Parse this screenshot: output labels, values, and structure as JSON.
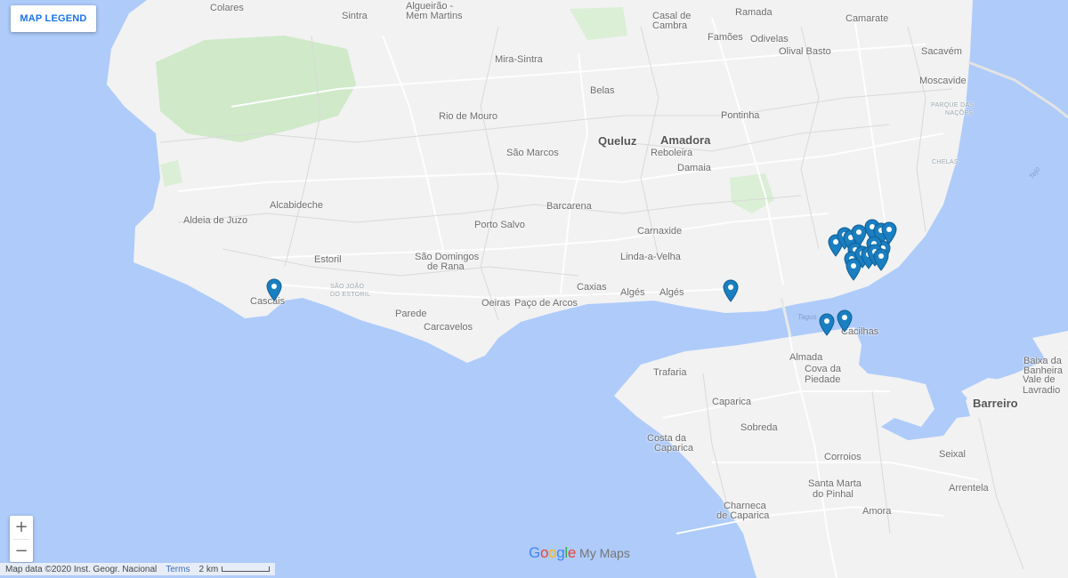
{
  "legend_button": "MAP LEGEND",
  "zoom": {
    "in": "+",
    "out": "−"
  },
  "attribution": {
    "data": "Map data ©2020 Inst. Geogr. Nacional",
    "terms": "Terms",
    "scale": "2 km"
  },
  "branding": {
    "google": "Google",
    "product": "My Maps"
  },
  "colors": {
    "water": "#aecbfa",
    "land": "#f2f2f2",
    "park": "#cfe9c9",
    "pin": "#1a7fc1"
  },
  "labels": [
    {
      "text": "Colares",
      "k": "n"
    },
    {
      "text": "Sintra",
      "k": "n"
    },
    {
      "text": "Algueirão -",
      "k": "n"
    },
    {
      "text": "Mem Martins",
      "k": "n"
    },
    {
      "text": "Mira-Sintra",
      "k": "n"
    },
    {
      "text": "Casal de",
      "k": "n"
    },
    {
      "text": "Cambra",
      "k": "n"
    },
    {
      "text": "Ramada",
      "k": "n"
    },
    {
      "text": "Famões",
      "k": "n"
    },
    {
      "text": "Odivelas",
      "k": "n"
    },
    {
      "text": "Camarate",
      "k": "n"
    },
    {
      "text": "Olival Basto",
      "k": "n"
    },
    {
      "text": "Sacavém",
      "k": "n"
    },
    {
      "text": "Moscavide",
      "k": "n"
    },
    {
      "text": "Belas",
      "k": "n"
    },
    {
      "text": "Rio de Mouro",
      "k": "n"
    },
    {
      "text": "Pontinha",
      "k": "n"
    },
    {
      "text": "Queluz",
      "k": "b"
    },
    {
      "text": "Amadora",
      "k": "b"
    },
    {
      "text": "São Marcos",
      "k": "n"
    },
    {
      "text": "Reboleira",
      "k": "n"
    },
    {
      "text": "Damaia",
      "k": "n"
    },
    {
      "text": "Alcabideche",
      "k": "n"
    },
    {
      "text": "Aldeia de Juzo",
      "k": "n"
    },
    {
      "text": "Barcarena",
      "k": "n"
    },
    {
      "text": "Porto Salvo",
      "k": "n"
    },
    {
      "text": "Carnaxide",
      "k": "n"
    },
    {
      "text": "Estoril",
      "k": "n"
    },
    {
      "text": "São Domingos",
      "k": "n"
    },
    {
      "text": "de Rana",
      "k": "n"
    },
    {
      "text": "Linda-a-Velha",
      "k": "n"
    },
    {
      "text": "Cascais",
      "k": "n"
    },
    {
      "text": "Caxias",
      "k": "n"
    },
    {
      "text": "Algés",
      "k": "n"
    },
    {
      "text": "Algés",
      "k": "n"
    },
    {
      "text": "Oeiras",
      "k": "n"
    },
    {
      "text": "Paço de Arcos",
      "k": "n"
    },
    {
      "text": "Parede",
      "k": "n"
    },
    {
      "text": "Carcavelos",
      "k": "n"
    },
    {
      "text": "Almada",
      "k": "n"
    },
    {
      "text": "Cova da",
      "k": "n"
    },
    {
      "text": "Piedade",
      "k": "n"
    },
    {
      "text": "Cacilhas",
      "k": "n"
    },
    {
      "text": "Trafaria",
      "k": "n"
    },
    {
      "text": "Caparica",
      "k": "n"
    },
    {
      "text": "Sobreda",
      "k": "n"
    },
    {
      "text": "Costa da",
      "k": "n"
    },
    {
      "text": "Caparica",
      "k": "n"
    },
    {
      "text": "Corroios",
      "k": "n"
    },
    {
      "text": "Santa Marta",
      "k": "n"
    },
    {
      "text": "do Pinhal",
      "k": "n"
    },
    {
      "text": "Charneca",
      "k": "n"
    },
    {
      "text": "de Caparica",
      "k": "n"
    },
    {
      "text": "Amora",
      "k": "n"
    },
    {
      "text": "Seixal",
      "k": "n"
    },
    {
      "text": "Arrentela",
      "k": "n"
    },
    {
      "text": "Barreiro",
      "k": "b"
    },
    {
      "text": "Baixa da",
      "k": "n"
    },
    {
      "text": "Banheira",
      "k": "n"
    },
    {
      "text": "Vale de",
      "k": "n"
    },
    {
      "text": "Lavradio",
      "k": "n"
    },
    {
      "text": "CHELAS",
      "k": "t"
    },
    {
      "text": "PARQUE DAS",
      "k": "t"
    },
    {
      "text": "NAÇÕES",
      "k": "t"
    },
    {
      "text": "SÃO JOÃO",
      "k": "t"
    },
    {
      "text": "DO ESTORIL",
      "k": "t"
    },
    {
      "text": "Tagus",
      "k": "w"
    },
    {
      "text": "Tejo",
      "k": "w"
    }
  ],
  "pins_count": 20
}
